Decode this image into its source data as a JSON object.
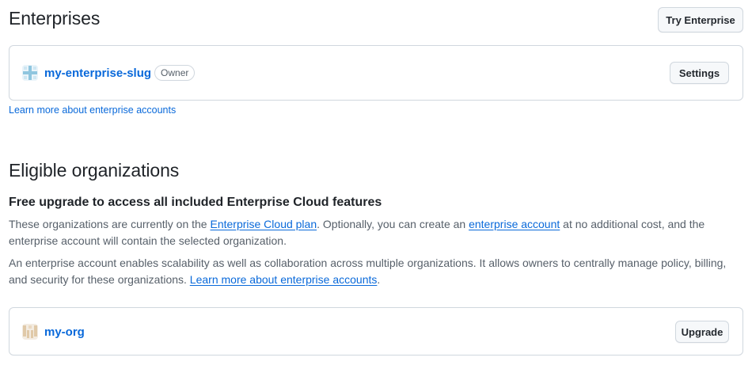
{
  "enterprises": {
    "heading": "Enterprises",
    "try_button": "Try Enterprise",
    "items": [
      {
        "name": "my-enterprise-slug",
        "role_badge": "Owner",
        "settings_button": "Settings",
        "avatar_color": "#8fc6df"
      }
    ],
    "learn_more": "Learn more about enterprise accounts"
  },
  "eligible": {
    "heading": "Eligible organizations",
    "subheading": "Free upgrade to access all included Enterprise Cloud features",
    "para1": {
      "t1": "These organizations are currently on the ",
      "link1": "Enterprise Cloud plan",
      "t2": ". Optionally, you can create an ",
      "link2": "enterprise account",
      "t3": " at no additional cost, and the enterprise account will contain the selected organization."
    },
    "para2": {
      "t1": "An enterprise account enables scalability as well as collaboration across multiple organizations. It allows owners to centrally manage policy, billing, and security for these organizations. ",
      "link1": "Learn more about enterprise accounts",
      "t2": "."
    },
    "orgs": [
      {
        "name": "my-org",
        "upgrade_button": "Upgrade",
        "avatar_color": "#e0c9a8"
      }
    ]
  },
  "colors": {
    "link": "#0969da",
    "text": "#1f2328",
    "muted": "#57606a",
    "border": "#d0d7de"
  }
}
